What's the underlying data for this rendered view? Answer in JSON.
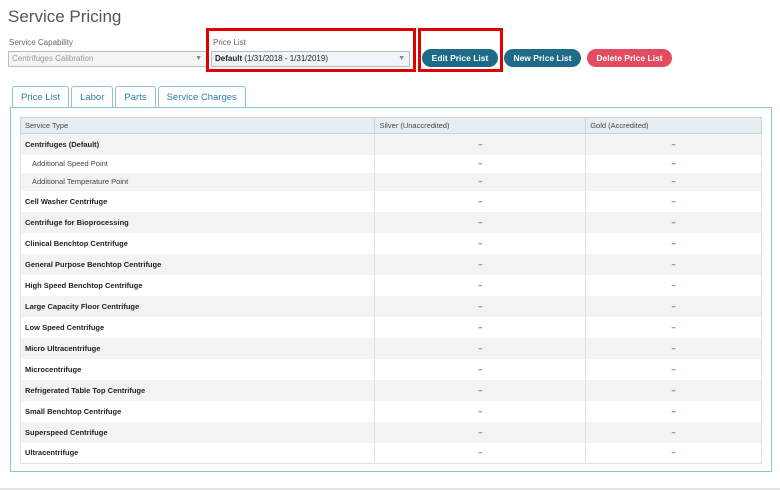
{
  "page": {
    "title": "Service Pricing"
  },
  "filters": {
    "capability_label": "Service Capability",
    "capability_value": "Centrifuges Calibration",
    "pricelist_label": "Price List",
    "pricelist_value_bold": "Default",
    "pricelist_value_range": "(1/31/2018 - 1/31/2019)"
  },
  "actions": {
    "edit_label": "Edit Price List",
    "new_label": "New Price List",
    "delete_label": "Delete Price List"
  },
  "tabs": [
    {
      "label": "Price List",
      "active": true
    },
    {
      "label": "Labor",
      "active": false
    },
    {
      "label": "Parts",
      "active": false
    },
    {
      "label": "Service Charges",
      "active": false
    }
  ],
  "table": {
    "headers": [
      "Service Type",
      "Silver (Unaccredited)",
      "Gold (Accredited)"
    ],
    "rows": [
      {
        "name": "Centrifuges (Default)",
        "kind": "main",
        "silver": "–",
        "gold": "–"
      },
      {
        "name": "Additional Speed Point",
        "kind": "sub",
        "silver": "–",
        "gold": "–"
      },
      {
        "name": "Additional Temperature Point",
        "kind": "sub",
        "silver": "–",
        "gold": "–"
      },
      {
        "name": "Cell Washer Centrifuge",
        "kind": "main",
        "silver": "–",
        "gold": "–"
      },
      {
        "name": "Centrifuge for Bioprocessing",
        "kind": "main",
        "silver": "–",
        "gold": "–"
      },
      {
        "name": "Clinical Benchtop Centrifuge",
        "kind": "main",
        "silver": "–",
        "gold": "–"
      },
      {
        "name": "General Purpose Benchtop Centrifuge",
        "kind": "main",
        "silver": "–",
        "gold": "–"
      },
      {
        "name": "High Speed Benchtop Centrifuge",
        "kind": "main",
        "silver": "–",
        "gold": "–"
      },
      {
        "name": "Large Capacity Floor Centrifuge",
        "kind": "main",
        "silver": "–",
        "gold": "–"
      },
      {
        "name": "Low Speed Centrifuge",
        "kind": "main",
        "silver": "–",
        "gold": "–"
      },
      {
        "name": "Micro Ultracentrifuge",
        "kind": "main",
        "silver": "–",
        "gold": "–"
      },
      {
        "name": "Microcentrifuge",
        "kind": "main",
        "silver": "–",
        "gold": "–"
      },
      {
        "name": "Refrigerated Table Top Centrifuge",
        "kind": "main",
        "silver": "–",
        "gold": "–"
      },
      {
        "name": "Small Benchtop Centrifuge",
        "kind": "main",
        "silver": "–",
        "gold": "–"
      },
      {
        "name": "Superspeed Centrifuge",
        "kind": "main",
        "silver": "–",
        "gold": "–"
      },
      {
        "name": "Ultracentrifuge",
        "kind": "main",
        "silver": "–",
        "gold": "–"
      }
    ]
  },
  "colors": {
    "primary_button": "#1f6b87",
    "danger_button": "#e34b5e",
    "highlight_outline": "#e00000",
    "tab_accent": "#2a7fa8"
  }
}
